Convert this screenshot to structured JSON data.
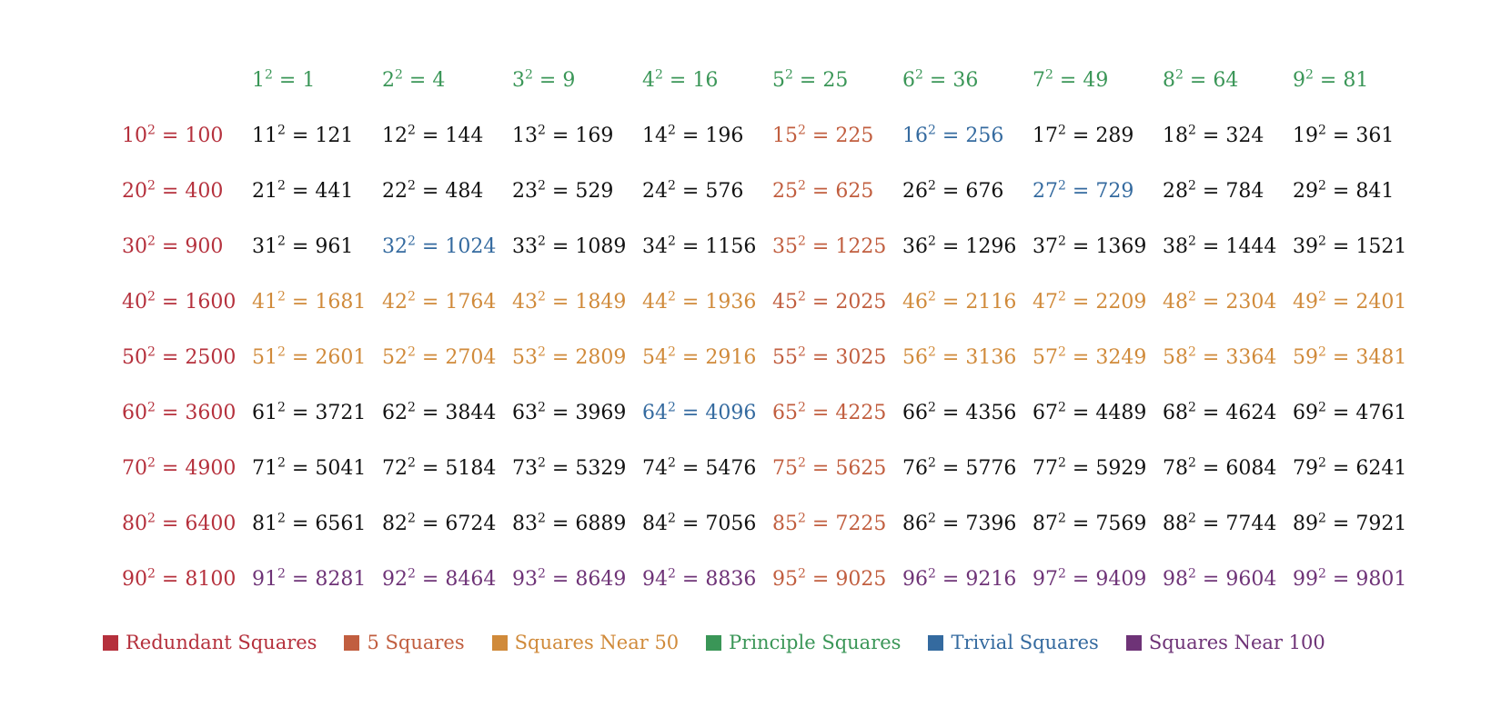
{
  "colors": {
    "redundant": "#b5303c",
    "five": "#c15e3f",
    "near50": "#d08a3a",
    "principle": "#3a9657",
    "trivial": "#346a9f",
    "near100": "#6e3377",
    "plain": "#111111"
  },
  "rows": [
    [
      null,
      {
        "b": "1",
        "v": "1",
        "c": "principle"
      },
      {
        "b": "2",
        "v": "4",
        "c": "principle"
      },
      {
        "b": "3",
        "v": "9",
        "c": "principle"
      },
      {
        "b": "4",
        "v": "16",
        "c": "principle"
      },
      {
        "b": "5",
        "v": "25",
        "c": "principle"
      },
      {
        "b": "6",
        "v": "36",
        "c": "principle"
      },
      {
        "b": "7",
        "v": "49",
        "c": "principle"
      },
      {
        "b": "8",
        "v": "64",
        "c": "principle"
      },
      {
        "b": "9",
        "v": "81",
        "c": "principle"
      }
    ],
    [
      {
        "b": "10",
        "v": "100",
        "c": "redundant"
      },
      {
        "b": "11",
        "v": "121",
        "c": "plain"
      },
      {
        "b": "12",
        "v": "144",
        "c": "plain"
      },
      {
        "b": "13",
        "v": "169",
        "c": "plain"
      },
      {
        "b": "14",
        "v": "196",
        "c": "plain"
      },
      {
        "b": "15",
        "v": "225",
        "c": "five"
      },
      {
        "b": "16",
        "v": "256",
        "c": "trivial"
      },
      {
        "b": "17",
        "v": "289",
        "c": "plain"
      },
      {
        "b": "18",
        "v": "324",
        "c": "plain"
      },
      {
        "b": "19",
        "v": "361",
        "c": "plain"
      }
    ],
    [
      {
        "b": "20",
        "v": "400",
        "c": "redundant"
      },
      {
        "b": "21",
        "v": "441",
        "c": "plain"
      },
      {
        "b": "22",
        "v": "484",
        "c": "plain"
      },
      {
        "b": "23",
        "v": "529",
        "c": "plain"
      },
      {
        "b": "24",
        "v": "576",
        "c": "plain"
      },
      {
        "b": "25",
        "v": "625",
        "c": "five"
      },
      {
        "b": "26",
        "v": "676",
        "c": "plain"
      },
      {
        "b": "27",
        "v": "729",
        "c": "trivial"
      },
      {
        "b": "28",
        "v": "784",
        "c": "plain"
      },
      {
        "b": "29",
        "v": "841",
        "c": "plain"
      }
    ],
    [
      {
        "b": "30",
        "v": "900",
        "c": "redundant"
      },
      {
        "b": "31",
        "v": "961",
        "c": "plain"
      },
      {
        "b": "32",
        "v": "1024",
        "c": "trivial"
      },
      {
        "b": "33",
        "v": "1089",
        "c": "plain"
      },
      {
        "b": "34",
        "v": "1156",
        "c": "plain"
      },
      {
        "b": "35",
        "v": "1225",
        "c": "five"
      },
      {
        "b": "36",
        "v": "1296",
        "c": "plain"
      },
      {
        "b": "37",
        "v": "1369",
        "c": "plain"
      },
      {
        "b": "38",
        "v": "1444",
        "c": "plain"
      },
      {
        "b": "39",
        "v": "1521",
        "c": "plain"
      }
    ],
    [
      {
        "b": "40",
        "v": "1600",
        "c": "redundant"
      },
      {
        "b": "41",
        "v": "1681",
        "c": "near50"
      },
      {
        "b": "42",
        "v": "1764",
        "c": "near50"
      },
      {
        "b": "43",
        "v": "1849",
        "c": "near50"
      },
      {
        "b": "44",
        "v": "1936",
        "c": "near50"
      },
      {
        "b": "45",
        "v": "2025",
        "c": "five"
      },
      {
        "b": "46",
        "v": "2116",
        "c": "near50"
      },
      {
        "b": "47",
        "v": "2209",
        "c": "near50"
      },
      {
        "b": "48",
        "v": "2304",
        "c": "near50"
      },
      {
        "b": "49",
        "v": "2401",
        "c": "near50"
      }
    ],
    [
      {
        "b": "50",
        "v": "2500",
        "c": "redundant"
      },
      {
        "b": "51",
        "v": "2601",
        "c": "near50"
      },
      {
        "b": "52",
        "v": "2704",
        "c": "near50"
      },
      {
        "b": "53",
        "v": "2809",
        "c": "near50"
      },
      {
        "b": "54",
        "v": "2916",
        "c": "near50"
      },
      {
        "b": "55",
        "v": "3025",
        "c": "five"
      },
      {
        "b": "56",
        "v": "3136",
        "c": "near50"
      },
      {
        "b": "57",
        "v": "3249",
        "c": "near50"
      },
      {
        "b": "58",
        "v": "3364",
        "c": "near50"
      },
      {
        "b": "59",
        "v": "3481",
        "c": "near50"
      }
    ],
    [
      {
        "b": "60",
        "v": "3600",
        "c": "redundant"
      },
      {
        "b": "61",
        "v": "3721",
        "c": "plain"
      },
      {
        "b": "62",
        "v": "3844",
        "c": "plain"
      },
      {
        "b": "63",
        "v": "3969",
        "c": "plain"
      },
      {
        "b": "64",
        "v": "4096",
        "c": "trivial"
      },
      {
        "b": "65",
        "v": "4225",
        "c": "five"
      },
      {
        "b": "66",
        "v": "4356",
        "c": "plain"
      },
      {
        "b": "67",
        "v": "4489",
        "c": "plain"
      },
      {
        "b": "68",
        "v": "4624",
        "c": "plain"
      },
      {
        "b": "69",
        "v": "4761",
        "c": "plain"
      }
    ],
    [
      {
        "b": "70",
        "v": "4900",
        "c": "redundant"
      },
      {
        "b": "71",
        "v": "5041",
        "c": "plain"
      },
      {
        "b": "72",
        "v": "5184",
        "c": "plain"
      },
      {
        "b": "73",
        "v": "5329",
        "c": "plain"
      },
      {
        "b": "74",
        "v": "5476",
        "c": "plain"
      },
      {
        "b": "75",
        "v": "5625",
        "c": "five"
      },
      {
        "b": "76",
        "v": "5776",
        "c": "plain"
      },
      {
        "b": "77",
        "v": "5929",
        "c": "plain"
      },
      {
        "b": "78",
        "v": "6084",
        "c": "plain"
      },
      {
        "b": "79",
        "v": "6241",
        "c": "plain"
      }
    ],
    [
      {
        "b": "80",
        "v": "6400",
        "c": "redundant"
      },
      {
        "b": "81",
        "v": "6561",
        "c": "plain"
      },
      {
        "b": "82",
        "v": "6724",
        "c": "plain"
      },
      {
        "b": "83",
        "v": "6889",
        "c": "plain"
      },
      {
        "b": "84",
        "v": "7056",
        "c": "plain"
      },
      {
        "b": "85",
        "v": "7225",
        "c": "five"
      },
      {
        "b": "86",
        "v": "7396",
        "c": "plain"
      },
      {
        "b": "87",
        "v": "7569",
        "c": "plain"
      },
      {
        "b": "88",
        "v": "7744",
        "c": "plain"
      },
      {
        "b": "89",
        "v": "7921",
        "c": "plain"
      }
    ],
    [
      {
        "b": "90",
        "v": "8100",
        "c": "redundant"
      },
      {
        "b": "91",
        "v": "8281",
        "c": "near100"
      },
      {
        "b": "92",
        "v": "8464",
        "c": "near100"
      },
      {
        "b": "93",
        "v": "8649",
        "c": "near100"
      },
      {
        "b": "94",
        "v": "8836",
        "c": "near100"
      },
      {
        "b": "95",
        "v": "9025",
        "c": "five"
      },
      {
        "b": "96",
        "v": "9216",
        "c": "near100"
      },
      {
        "b": "97",
        "v": "9409",
        "c": "near100"
      },
      {
        "b": "98",
        "v": "9604",
        "c": "near100"
      },
      {
        "b": "99",
        "v": "9801",
        "c": "near100"
      }
    ]
  ],
  "legend": [
    {
      "label": "Redundant Squares",
      "c": "redundant"
    },
    {
      "label": "5 Squares",
      "c": "five"
    },
    {
      "label": "Squares Near 50",
      "c": "near50"
    },
    {
      "label": "Principle Squares",
      "c": "principle"
    },
    {
      "label": "Trivial Squares",
      "c": "trivial"
    },
    {
      "label": "Squares Near 100",
      "c": "near100"
    }
  ]
}
